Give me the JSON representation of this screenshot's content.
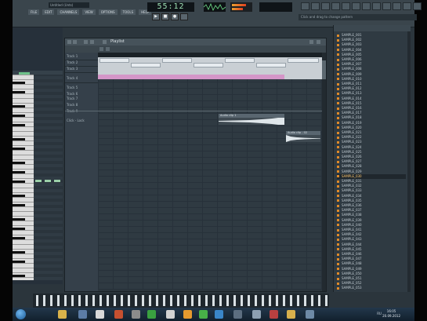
{
  "toolbar": {
    "song_title": "Untitled (Unts)",
    "menu": [
      "FILE",
      "EDIT",
      "CHANNELS",
      "VIEW",
      "OPTIONS",
      "TOOLS",
      "HELP"
    ],
    "tempo": "55:12",
    "hint": "Click and drag to change pattern"
  },
  "playlist": {
    "title": "Playlist",
    "tracks": [
      "Track 1",
      "Track 2",
      "Track 3",
      "Track 4",
      "Track 5",
      "Track 6",
      "Track 7",
      "Track 8",
      "Track 9"
    ],
    "track_sub": "Click - Lock"
  },
  "clips": [
    {
      "label": "Audio clip 1"
    },
    {
      "label": "Audio clip - 02"
    }
  ],
  "browser": {
    "items": [
      "SAMPLE_001",
      "SAMPLE_002",
      "SAMPLE_003",
      "SAMPLE_004",
      "SAMPLE_005",
      "SAMPLE_006",
      "SAMPLE_007",
      "SAMPLE_008",
      "SAMPLE_009",
      "SAMPLE_010",
      "SAMPLE_011",
      "SAMPLE_012",
      "SAMPLE_013",
      "SAMPLE_014",
      "SAMPLE_015",
      "SAMPLE_016",
      "SAMPLE_017",
      "SAMPLE_018",
      "SAMPLE_019",
      "SAMPLE_020",
      "SAMPLE_021",
      "SAMPLE_022",
      "SAMPLE_023",
      "SAMPLE_024",
      "SAMPLE_025",
      "SAMPLE_026",
      "SAMPLE_027",
      "SAMPLE_028",
      "SAMPLE_029",
      "SAMPLE_030",
      "SAMPLE_031",
      "SAMPLE_032",
      "SAMPLE_033",
      "SAMPLE_034",
      "SAMPLE_035",
      "SAMPLE_036",
      "SAMPLE_037",
      "SAMPLE_038",
      "SAMPLE_039",
      "SAMPLE_040",
      "SAMPLE_041",
      "SAMPLE_042",
      "SAMPLE_043",
      "SAMPLE_044",
      "SAMPLE_045",
      "SAMPLE_046",
      "SAMPLE_047",
      "SAMPLE_048",
      "SAMPLE_049",
      "SAMPLE_050",
      "SAMPLE_051",
      "SAMPLE_052",
      "SAMPLE_053"
    ],
    "selected_index": 29
  },
  "taskbar": {
    "time": "16:05",
    "date": "20.09.2012",
    "tray_lang": "RU"
  },
  "colors": {
    "accent_orange": "#e08a28",
    "pattern_pink": "#d496c8",
    "tempo_green": "#9ee0b4"
  }
}
